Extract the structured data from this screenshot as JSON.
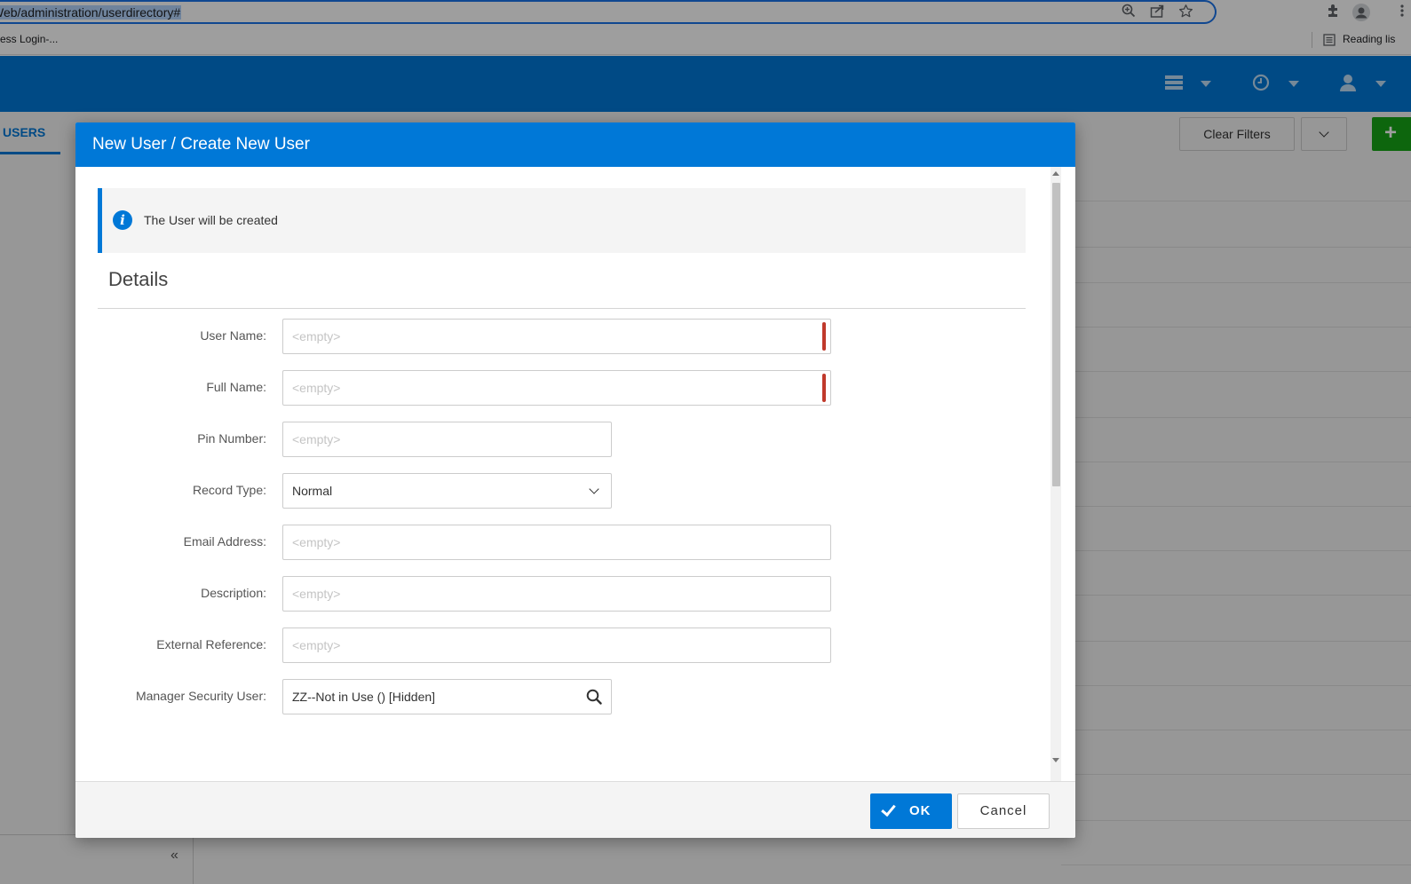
{
  "browser": {
    "url": "Web/administration/userdirectory#",
    "bookmark_item": "ess Login-...",
    "reading_list": "Reading lis"
  },
  "page": {
    "tab_users": "USERS",
    "clear_filters": "Clear Filters",
    "add_icon": "+",
    "collapse_icon": "«"
  },
  "modal": {
    "title": "New User / Create New User",
    "info_text": "The User will be created",
    "section_title": "Details",
    "fields": {
      "user_name": {
        "label": "User Name:",
        "placeholder": "<empty>",
        "value": ""
      },
      "full_name": {
        "label": "Full Name:",
        "placeholder": "<empty>",
        "value": ""
      },
      "pin_number": {
        "label": "Pin Number:",
        "placeholder": "<empty>",
        "value": ""
      },
      "record_type": {
        "label": "Record Type:",
        "value": "Normal"
      },
      "email_address": {
        "label": "Email Address:",
        "placeholder": "<empty>",
        "value": ""
      },
      "description": {
        "label": "Description:",
        "placeholder": "<empty>",
        "value": ""
      },
      "external_reference": {
        "label": "External Reference:",
        "placeholder": "<empty>",
        "value": ""
      },
      "manager_security_user": {
        "label": "Manager Security User:",
        "value": "ZZ--Not in Use () [Hidden]"
      }
    },
    "ok_label": "OK",
    "cancel_label": "Cancel"
  },
  "colors": {
    "primary": "#0078d7",
    "add_green": "#16a516",
    "required": "#c0392b"
  },
  "icons": {
    "info": "info-icon",
    "search": "search-icon",
    "check": "check-icon",
    "chevron": "chevron-down-icon"
  }
}
